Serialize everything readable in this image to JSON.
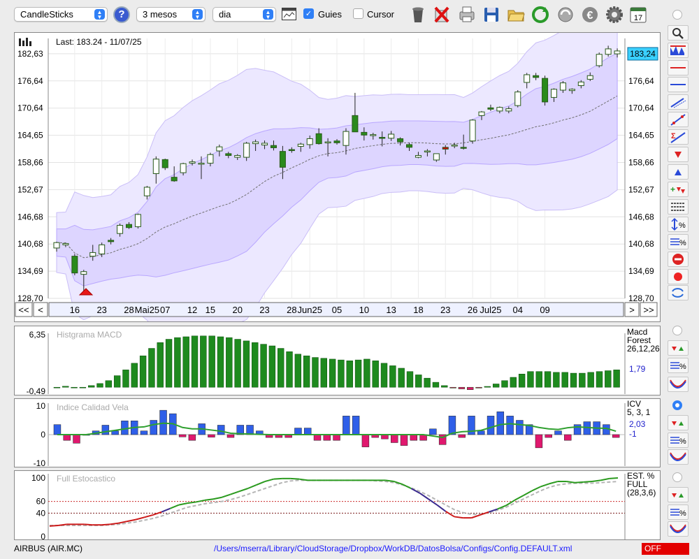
{
  "toolbar": {
    "chart_type": "CandleSticks",
    "help": "?",
    "period": "3 mesos",
    "interval": "dia",
    "guides_label": "Guies",
    "guides_checked": true,
    "cursor_label": "Cursor",
    "cursor_checked": false,
    "calendar_day": "17",
    "icons": [
      "trash-icon",
      "delete-icon",
      "print-icon",
      "save-icon",
      "open-folder-icon",
      "refresh-icon",
      "sync-icon",
      "euro-icon",
      "settings-icon",
      "calendar-icon"
    ]
  },
  "main_chart": {
    "last_label": "Last: 183.24 - 11/07/25",
    "current_price": "183,24",
    "nav": {
      "first": "<<",
      "prev": "<",
      "next": ">",
      "last": ">>"
    }
  },
  "macd": {
    "title": "Histgrama MACD",
    "legend": [
      "Macd",
      "Forest",
      "26,12,26"
    ],
    "value": "1,79"
  },
  "icv": {
    "title": "Indice Calidad Vela",
    "legend": [
      "ICV",
      "5, 3, 1"
    ],
    "values": [
      "2,03",
      "-1"
    ]
  },
  "stoch": {
    "title": "Full Estocastico",
    "legend": [
      "EST. %",
      "FULL",
      "(28,3,6)"
    ]
  },
  "footer": {
    "name": "AIRBUS (AIR.MC)",
    "path": "/Users/mserra/Library/CloudStorage/Dropbox/WorkDB/DatosBolsa/Configs/Config.DEFAULT.xml",
    "status": "OFF"
  },
  "sidebar": {
    "icons": [
      "zoom-icon",
      "candle-style-icon",
      "horizontal-line-red-icon",
      "horizontal-line-blue-icon",
      "channel-icon",
      "trendline-icon",
      "fibonacci-icon",
      "arrow-down-icon",
      "arrow-up-icon",
      "signals-icon",
      "lines-icon",
      "percent-scale-icon",
      "percent-lines-icon",
      "stop-icon",
      "record-icon",
      "swap-icon",
      "macd-signals-icon",
      "macd-percent-icon",
      "macd-wave-icon",
      "icv-signals-icon",
      "icv-percent-icon",
      "icv-wave-icon",
      "stoch-signals-icon",
      "stoch-percent-icon",
      "stoch-wave-icon"
    ]
  },
  "chart_data": [
    {
      "type": "candlestick",
      "title": "",
      "ylabel": "",
      "xlabel": "",
      "ylim": [
        128.7,
        186.0
      ],
      "yticks": [
        "128,70",
        "134,69",
        "140,68",
        "146,68",
        "152,67",
        "158,66",
        "164,65",
        "170,64",
        "176,64",
        "182,63"
      ],
      "xticks": [
        "16",
        "23",
        "28",
        "Mai25",
        "07",
        "12",
        "15",
        "20",
        "23",
        "28",
        "Jun25",
        "05",
        "10",
        "13",
        "18",
        "23",
        "26",
        "Jul25",
        "04",
        "09"
      ],
      "candles": [
        [
          139.8,
          141.2,
          139.0,
          141.0
        ],
        [
          140.5,
          141.0,
          140.0,
          140.8
        ],
        [
          138.0,
          138.5,
          133.8,
          134.3
        ],
        [
          134.0,
          135.0,
          130.0,
          134.6
        ],
        [
          138.0,
          140.5,
          137.0,
          138.8
        ],
        [
          138.5,
          141.0,
          137.8,
          140.5
        ],
        [
          141.5,
          142.0,
          140.6,
          141.2
        ],
        [
          143.0,
          145.2,
          142.3,
          144.8
        ],
        [
          145.0,
          145.5,
          144.0,
          144.3
        ],
        [
          144.5,
          147.4,
          144.1,
          147.2
        ],
        [
          151.3,
          153.5,
          150.5,
          153.2
        ],
        [
          156.2,
          160.0,
          154.0,
          159.4
        ],
        [
          159.3,
          159.5,
          157.0,
          157.5
        ],
        [
          155.4,
          157.8,
          154.4,
          154.6
        ],
        [
          156.4,
          158.6,
          155.8,
          158.4
        ],
        [
          158.5,
          159.3,
          158.0,
          158.8
        ],
        [
          158.4,
          160.0,
          155.0,
          158.5
        ],
        [
          158.5,
          160.8,
          157.8,
          160.4
        ],
        [
          161.2,
          162.6,
          160.0,
          162.1
        ],
        [
          160.6,
          161.0,
          159.6,
          160.2
        ],
        [
          159.8,
          160.5,
          159.2,
          160.2
        ],
        [
          159.8,
          163.2,
          159.0,
          162.9
        ],
        [
          162.8,
          163.7,
          161.2,
          163.2
        ],
        [
          162.5,
          163.5,
          161.6,
          162.9
        ],
        [
          162.4,
          163.5,
          161.3,
          161.9
        ],
        [
          161.1,
          162.3,
          155.0,
          157.6
        ],
        [
          161.5,
          162.0,
          160.8,
          161.4
        ],
        [
          162.2,
          163.0,
          161.0,
          162.7
        ],
        [
          162.6,
          164.6,
          161.7,
          163.9
        ],
        [
          165.0,
          166.2,
          162.6,
          162.8
        ],
        [
          163.0,
          164.0,
          160.0,
          163.2
        ],
        [
          163.4,
          163.8,
          162.6,
          163.0
        ],
        [
          162.4,
          166.2,
          160.4,
          165.5
        ],
        [
          169.0,
          174.0,
          165.6,
          165.4
        ],
        [
          165.3,
          166.4,
          163.5,
          164.7
        ],
        [
          164.6,
          165.2,
          163.7,
          164.8
        ],
        [
          164.2,
          165.5,
          162.2,
          164.1
        ],
        [
          164.0,
          165.6,
          163.4,
          164.9
        ],
        [
          163.9,
          164.2,
          162.4,
          163.2
        ],
        [
          162.6,
          163.0,
          161.2,
          162.0
        ],
        [
          159.8,
          161.0,
          159.6,
          160.2
        ],
        [
          161.0,
          161.6,
          160.0,
          161.2
        ],
        [
          159.2,
          160.0,
          158.8,
          160.6
        ],
        [
          162.0,
          162.5,
          160.4,
          161.6
        ],
        [
          162.5,
          163.0,
          161.8,
          162.5
        ],
        [
          162.0,
          164.8,
          161.5,
          161.8
        ],
        [
          163.4,
          168.2,
          162.8,
          168.0
        ],
        [
          169.0,
          170.0,
          168.0,
          169.8
        ],
        [
          170.7,
          171.4,
          170.0,
          170.4
        ],
        [
          170.0,
          171.0,
          169.5,
          170.8
        ],
        [
          170.0,
          171.0,
          169.5,
          170.5
        ],
        [
          171.2,
          174.6,
          170.8,
          174.2
        ],
        [
          176.3,
          178.4,
          175.0,
          178.0
        ],
        [
          177.8,
          178.4,
          176.8,
          177.4
        ],
        [
          177.2,
          177.8,
          171.2,
          172.0
        ],
        [
          173.0,
          175.0,
          172.0,
          174.8
        ],
        [
          174.6,
          176.6,
          174.0,
          176.2
        ],
        [
          174.5,
          175.0,
          173.8,
          174.8
        ],
        [
          175.6,
          176.8,
          175.0,
          176.4
        ],
        [
          177.0,
          178.5,
          176.6,
          177.8
        ],
        [
          180.0,
          182.9,
          179.6,
          182.5
        ],
        [
          182.5,
          184.4,
          182.0,
          183.7
        ],
        [
          182.6,
          183.8,
          181.8,
          183.24
        ]
      ],
      "colors": {
        "up": "#ffffff",
        "down": "#2a8a1c",
        "down_last": "#e00000",
        "bands": "#b9a7ff",
        "ma": "#707070"
      }
    },
    {
      "type": "bar",
      "title": "Histgrama MACD",
      "ylim": [
        -0.49,
        6.35
      ],
      "yticks": [
        "6,35",
        "-0,49"
      ],
      "values": [
        0,
        0.12,
        0,
        0,
        0.2,
        0.45,
        0.8,
        1.4,
        2.1,
        2.9,
        3.8,
        4.7,
        5.4,
        5.8,
        6.0,
        6.1,
        6.2,
        6.2,
        6.2,
        6.1,
        6.0,
        5.8,
        5.6,
        5.4,
        5.2,
        5.0,
        4.7,
        4.3,
        4.0,
        3.8,
        3.6,
        3.5,
        3.4,
        3.3,
        3.2,
        3.3,
        3.4,
        3.2,
        2.9,
        2.6,
        2.3,
        1.9,
        1.5,
        1.1,
        0.6,
        0.2,
        -0.1,
        -0.2,
        -0.3,
        -0.1,
        0.1,
        0.4,
        0.8,
        1.2,
        1.6,
        1.9,
        1.9,
        1.9,
        1.8,
        1.8,
        1.7,
        1.7,
        1.8,
        1.9,
        2.0,
        2.1
      ],
      "colors": {
        "positive": "#1e8a1e",
        "negative": "#e0186e"
      }
    },
    {
      "type": "bar",
      "title": "Indice Calidad Vela",
      "ylim": [
        -10,
        10
      ],
      "yticks": [
        "10",
        "0",
        "-10"
      ],
      "values": [
        3.5,
        -2,
        -3,
        0,
        1.3,
        3.3,
        1.3,
        4.8,
        4.8,
        1.3,
        5,
        8.5,
        7.3,
        -0.8,
        -2,
        3.8,
        -0.9,
        3.3,
        -1,
        3.3,
        3.3,
        1.3,
        -1,
        -1,
        -1,
        2.3,
        2.3,
        -2,
        -2,
        -2,
        6.5,
        6.5,
        -4.3,
        -1,
        -1.5,
        -2.8,
        -3.8,
        -2,
        -2,
        2,
        -3.5,
        6.5,
        -1,
        6.5,
        1.3,
        6.5,
        8,
        6.5,
        5,
        3.5,
        -4.6,
        -1,
        1.3,
        -2,
        3.5,
        4.5,
        4.5,
        3.5,
        -1
      ],
      "signal": [
        0,
        0,
        0,
        0,
        0.5,
        1,
        1.5,
        2,
        2.5,
        2.7,
        3.5,
        4,
        3.8,
        2.5,
        2,
        2,
        1.6,
        1.2,
        0.5,
        0.3,
        0.2,
        0.1,
        0,
        0,
        0,
        0,
        0,
        0,
        0,
        0,
        0,
        0,
        0,
        0,
        0,
        0,
        0,
        0,
        0,
        -0.5,
        -1,
        0.5,
        1,
        1.2,
        1.5,
        2.5,
        3.5,
        3.8,
        3.5,
        3.2,
        2.5,
        2,
        1.8,
        2.4,
        2.7,
        2.5,
        2.3,
        2.2,
        1.2
      ],
      "colors": {
        "positive": "#2f5fe8",
        "negative": "#e0186e",
        "signal": "#30a030"
      }
    },
    {
      "type": "line",
      "title": "Full Estocastico",
      "ylim": [
        0,
        100
      ],
      "yticks": [
        "100",
        "60",
        "40",
        "0"
      ],
      "reference_lines": [
        60,
        40
      ],
      "series": [
        {
          "values": [
            18,
            19,
            21,
            21,
            21,
            20,
            20,
            21,
            23,
            26,
            29,
            33,
            37,
            42,
            48,
            54,
            57,
            59,
            62,
            64,
            67,
            72,
            77,
            82,
            88,
            94,
            98,
            99,
            99,
            98,
            96,
            96,
            96,
            96,
            96,
            96,
            96,
            96,
            96,
            96,
            94,
            89,
            82,
            74,
            64,
            54,
            43,
            34,
            32,
            32,
            37,
            42,
            47,
            53,
            62,
            70,
            78,
            85,
            90,
            94,
            94,
            92,
            93,
            94,
            96,
            99,
            100
          ]
        },
        {
          "values": [
            19,
            19,
            19,
            19,
            19,
            19,
            19,
            20,
            21,
            23,
            25,
            28,
            31,
            35,
            40,
            45,
            50,
            53,
            56,
            58,
            60,
            63,
            67,
            72,
            77,
            82,
            87,
            92,
            95,
            96,
            96,
            96,
            96,
            96,
            96,
            96,
            96,
            96,
            95,
            94,
            92,
            88,
            83,
            77,
            70,
            62,
            54,
            46,
            41,
            38,
            38,
            41,
            45,
            50,
            57,
            64,
            71,
            78,
            84,
            88,
            90,
            91,
            91,
            91,
            92,
            93,
            94
          ]
        }
      ],
      "colors": {
        "k_up": "#2a9a1e",
        "k_down": "#cc1a1a",
        "k_mid": "#3a2a8e",
        "d": "#b5b5b5",
        "ref_60": "#cc2a2a",
        "ref_40": "#7a1a1a"
      }
    }
  ]
}
